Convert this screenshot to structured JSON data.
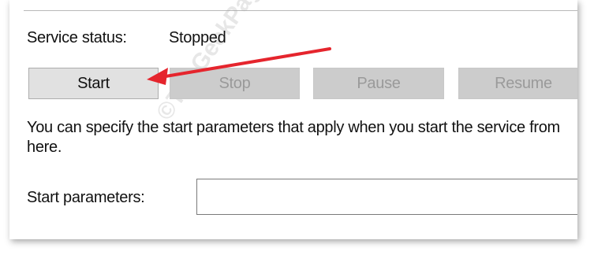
{
  "service": {
    "status_label": "Service status:",
    "status_value": "Stopped"
  },
  "buttons": {
    "start": "Start",
    "stop": "Stop",
    "pause": "Pause",
    "resume": "Resume"
  },
  "description": "You can specify the start parameters that apply when you start the service from here.",
  "parameters": {
    "label": "Start parameters:",
    "value": ""
  },
  "watermark": "©TheGeekPage.com",
  "annotation": {
    "arrow_color": "#e5252d"
  }
}
